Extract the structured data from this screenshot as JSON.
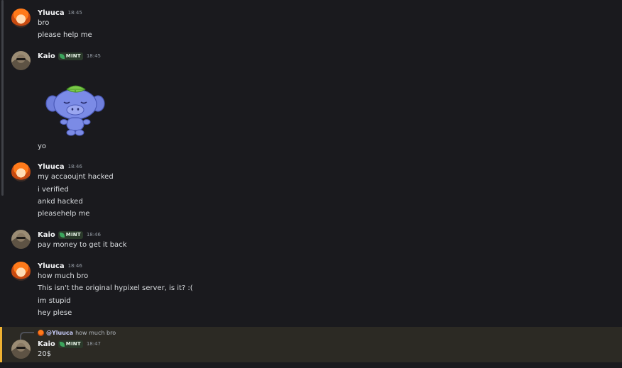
{
  "messages": [
    {
      "author": "Yluuca",
      "timestamp": "18:45",
      "lines": [
        "bro",
        "please help me"
      ]
    },
    {
      "author": "Kaio",
      "badge": "MINT",
      "timestamp": "18:45",
      "sticker": "wumpus-leaf-sticker",
      "lines": [
        "yo"
      ]
    },
    {
      "author": "Yluuca",
      "timestamp": "18:46",
      "lines": [
        "my accaoujnt hacked",
        "i verified",
        "ankd hacked",
        "pleasehelp me"
      ]
    },
    {
      "author": "Kaio",
      "badge": "MINT",
      "timestamp": "18:46",
      "lines": [
        "pay money to get it back"
      ]
    },
    {
      "author": "Yluuca",
      "timestamp": "18:46",
      "lines": [
        "how much bro",
        "This isn't the original hypixel server, is it? :(",
        "im stupid",
        "hey plese"
      ]
    },
    {
      "author": "Kaio",
      "badge": "MINT",
      "timestamp": "18:47",
      "reply": {
        "mention": "@Yluuca",
        "text": "how much bro"
      },
      "lines": [
        "20$"
      ]
    }
  ],
  "colors": {
    "background": "#1a1a1e",
    "highlight_bar": "#f0b232",
    "badge_leaf": "#3ba55c",
    "sticker_body": "#7b8be6"
  }
}
